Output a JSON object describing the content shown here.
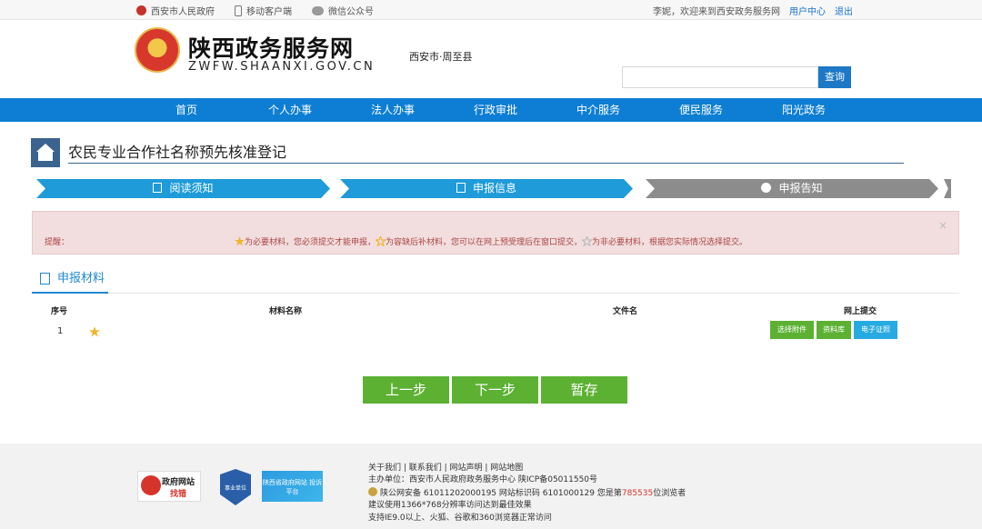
{
  "topbar": {
    "gov_link": "西安市人民政府",
    "mobile_link": "移动客户端",
    "wechat_link": "微信公众号",
    "welcome": "李妮，欢迎来到西安政务服务网",
    "user_center": "用户中心",
    "logout": "退出"
  },
  "header": {
    "site_title": "陕西政务服务网",
    "site_domain": "ZWFW.SHAANXI.GOV.CN",
    "region": "西安市·周至县",
    "search_placeholder": "",
    "search_button": "查询"
  },
  "nav": {
    "items": [
      "首页",
      "个人办事",
      "法人办事",
      "行政审批",
      "中介服务",
      "便民服务",
      "阳光政务"
    ]
  },
  "page": {
    "title": "农民专业合作社名称预先核准登记"
  },
  "steps": [
    {
      "label": "阅读须知",
      "state": "active",
      "icon": "document-icon"
    },
    {
      "label": "申报信息",
      "state": "active",
      "icon": "form-icon"
    },
    {
      "label": "申报告知",
      "state": "inactive",
      "icon": "info-icon"
    }
  ],
  "alert": {
    "label": "提醒：",
    "part1": "为必要材料，您必须提交才能申报，",
    "part2": "为容缺后补材料，您可以在网上预受理后在窗口提交，",
    "part3": "为非必要材料，根据您实际情况选择提交。",
    "close": "×"
  },
  "materials": {
    "tab_label": "申报材料",
    "headers": {
      "index": "序号",
      "name": "材料名称",
      "file": "文件名",
      "submit": "网上提交"
    },
    "rows": [
      {
        "index": "1",
        "required": true,
        "name": "",
        "file": ""
      }
    ],
    "buttons": {
      "choose": "选择附件",
      "library": "资料库",
      "e_cert": "电子证照"
    }
  },
  "actions": {
    "prev": "上一步",
    "next": "下一步",
    "save": "暂存"
  },
  "footer": {
    "links": "关于我们 | 联系我们 | 网站声明 | 网站地图",
    "host": "主办单位：西安市人民政府政务服务中心  陕ICP备05011550号",
    "security_prefix": "陕公网安备 61011202000195  网站标识码 6101000129  您是第",
    "visitor_count": "785535",
    "security_suffix": "位浏览者",
    "resolution": "建议使用1366*768分辨率访问达到最佳效果",
    "browser": "支持IE9.0以上、火狐、谷歌和360浏览器正常访问",
    "badge_gov_1": "政府网站",
    "badge_gov_2": "找错",
    "badge_unit": "事业单位",
    "badge_report": "陕西省政府网站 投诉平台"
  },
  "colors": {
    "nav_blue": "#0d7ed4",
    "step_active": "#1e9bd8",
    "step_inactive": "#8c8c8c",
    "action_green": "#5cb133",
    "alert_bg": "#f2dedf"
  }
}
